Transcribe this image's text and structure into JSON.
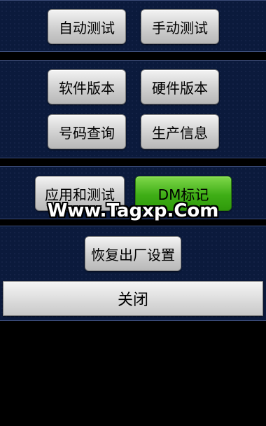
{
  "section1": {
    "auto_test": "自动测试",
    "manual_test": "手动测试"
  },
  "section2": {
    "software_version": "软件版本",
    "hardware_version": "硬件版本",
    "number_query": "号码查询",
    "production_info": "生产信息"
  },
  "section3": {
    "apps_and_test": "应用和测试",
    "dm_mark": "DM标记"
  },
  "section4": {
    "factory_reset": "恢复出厂设置"
  },
  "close_label": "关闭",
  "watermark_text": "Www.Tagxp.Com"
}
